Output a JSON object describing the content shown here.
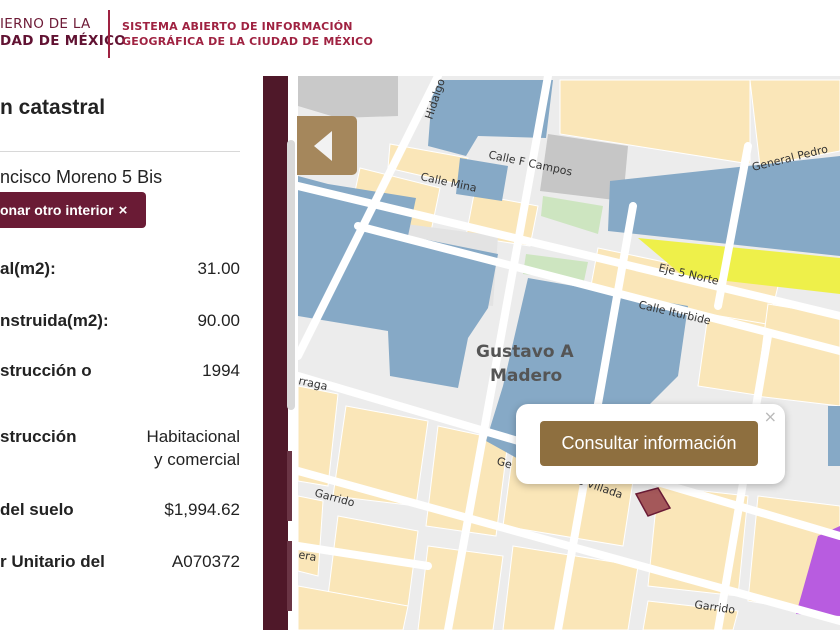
{
  "header": {
    "gov_logo_line1": "IERNO DE LA",
    "gov_logo_line2": "DAD DE MÉXICO",
    "system_title_line1": "SISTEMA ABIERTO DE INFORMACIÓN",
    "system_title_line2": "GEOGRÁFICA DE LA CIUDAD DE MÉXICO"
  },
  "panel": {
    "title": "n catastral",
    "address": "ncisco Moreno 5 Bis",
    "select_button_label": "onar otro interior",
    "select_button_icon": "×",
    "rows": [
      {
        "label": "al(m2):",
        "value": "31.00"
      },
      {
        "label": "nstruida(m2):",
        "value": "90.00"
      },
      {
        "label": "strucción o",
        "label2": "",
        "value": "1994"
      },
      {
        "label": "strucción",
        "value": "Habitacional",
        "value2": "y comercial"
      },
      {
        "label": " del suelo",
        "value": "$1,994.62"
      },
      {
        "label": "r Unitario del",
        "value": "A070372"
      }
    ]
  },
  "map": {
    "district_line1": "Gustavo A",
    "district_line2": "Madero",
    "streets": {
      "hidalgo": "Hidalgo",
      "calle_f_campos": "Calle F Campos",
      "calle_mina": "Calle Mina",
      "general_pedro": "General Pedro",
      "eje5": "Eje 5 Norte",
      "iturbide": "Calle Iturbide",
      "garrido": "Garrido",
      "garrido2": "Garrido",
      "arraga": "rraga",
      "vicente_villada": "Vicente Villada",
      "ge": "Ge",
      "era": "era"
    },
    "collapse_icon": "chevron-left-icon",
    "popup": {
      "close_label": "×",
      "button_label": "Consultar información"
    }
  },
  "colors": {
    "brand_maroon": "#611232",
    "brand_gold": "#8e6f3f",
    "building_blue": "#86a9c6",
    "block_beige": "#fae6b8"
  }
}
